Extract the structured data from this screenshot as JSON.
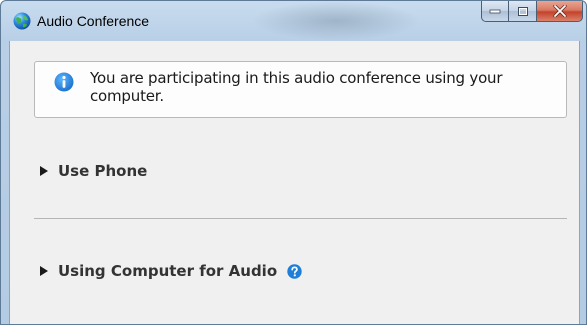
{
  "window": {
    "title": "Audio Conference",
    "controls": {
      "minimize": "minimize",
      "maximize": "maximize",
      "close": "close"
    }
  },
  "info": {
    "icon": "info-icon",
    "message": "You are participating in this audio conference using your computer."
  },
  "sections": [
    {
      "label": "Use Phone",
      "icon": "expand-triangle-icon",
      "expanded": false
    },
    {
      "label": "Using Computer for Audio",
      "icon": "expand-triangle-icon",
      "help_icon": "help-icon",
      "expanded": false
    }
  ],
  "colors": {
    "accent": "#1f7fd6",
    "close_button": "#c5422a",
    "client_background": "#f0f0f0"
  }
}
